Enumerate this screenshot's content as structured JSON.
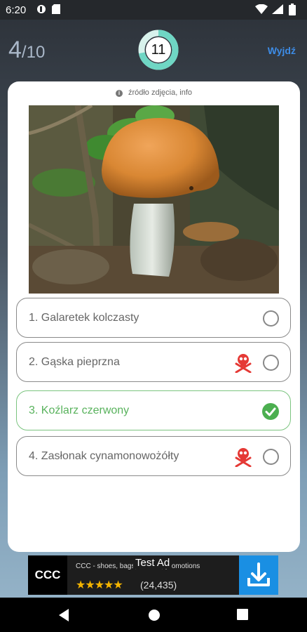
{
  "status_bar": {
    "time": "6:20"
  },
  "header": {
    "current": "4",
    "total": "/10",
    "timer": "11",
    "timer_progress": 0.72,
    "exit_label": "Wyjdź"
  },
  "card": {
    "source_text": "źródło zdjęcia, info",
    "answers": [
      {
        "label": "1. Galaretek kolczasty",
        "toxic": false,
        "state": "unselected"
      },
      {
        "label": "2. Gąska pieprzna",
        "toxic": true,
        "state": "unselected"
      },
      {
        "label": "3. Koźlarz czerwony",
        "toxic": false,
        "state": "correct"
      },
      {
        "label": "4. Zasłonak cynamonowożółty",
        "toxic": true,
        "state": "unselected"
      }
    ]
  },
  "ad": {
    "logo": "CCC",
    "text": "CCC - shoes, bags, fashion, promotions",
    "badge": "Test Ad",
    "stars": "★★★★★",
    "rating_count": "(24,435)"
  },
  "colors": {
    "accent_blue": "#3d8ce6",
    "timer_ring": "#6fd6c4",
    "correct_green": "#4caf50",
    "toxic_red": "#e53935"
  }
}
